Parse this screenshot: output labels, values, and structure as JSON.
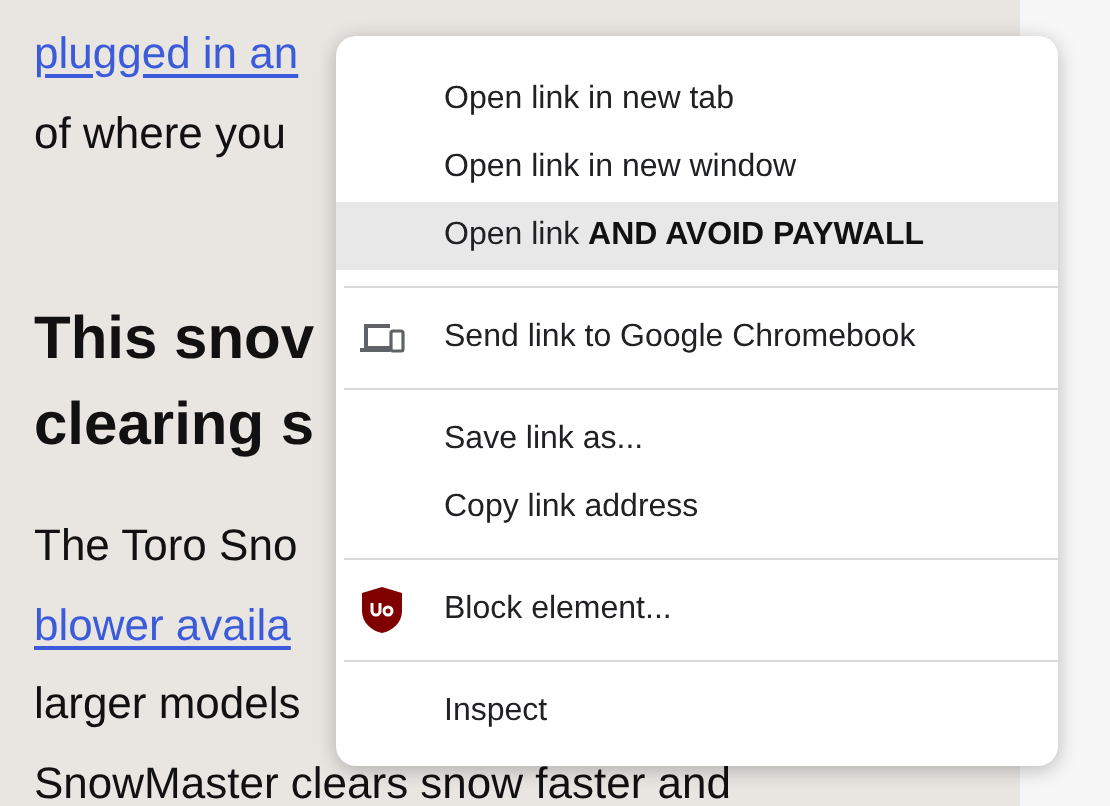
{
  "article": {
    "lines": [
      {
        "kind": "link",
        "text": "plugged in an"
      },
      {
        "kind": "text",
        "text": "of where you"
      },
      {
        "kind": "heading",
        "text": "This snov"
      },
      {
        "kind": "heading",
        "text": "clearing s"
      },
      {
        "kind": "text",
        "text": "The Toro Sno"
      },
      {
        "kind": "link",
        "text": "blower availa"
      },
      {
        "kind": "text",
        "text": "larger models"
      },
      {
        "kind": "text",
        "text": "SnowMaster clears snow faster and"
      }
    ]
  },
  "context_menu": {
    "groups": [
      [
        {
          "kind": "plain",
          "label": "Open link in new tab",
          "selected": false
        },
        {
          "kind": "plain",
          "label": "Open link in new window",
          "selected": false
        },
        {
          "kind": "plain",
          "label": "Open link **AND AVOID PAYWALL**",
          "selected": true
        }
      ],
      [
        {
          "kind": "send",
          "label": "Send link to Google Chromebook",
          "selected": false
        }
      ],
      [
        {
          "kind": "plain",
          "label": "Save link as...",
          "selected": false
        },
        {
          "kind": "plain",
          "label": "Copy link address",
          "selected": false
        }
      ],
      [
        {
          "kind": "block",
          "label": "Block element...",
          "selected": false
        }
      ],
      [
        {
          "kind": "plain",
          "label": "Inspect",
          "selected": false
        }
      ]
    ]
  }
}
